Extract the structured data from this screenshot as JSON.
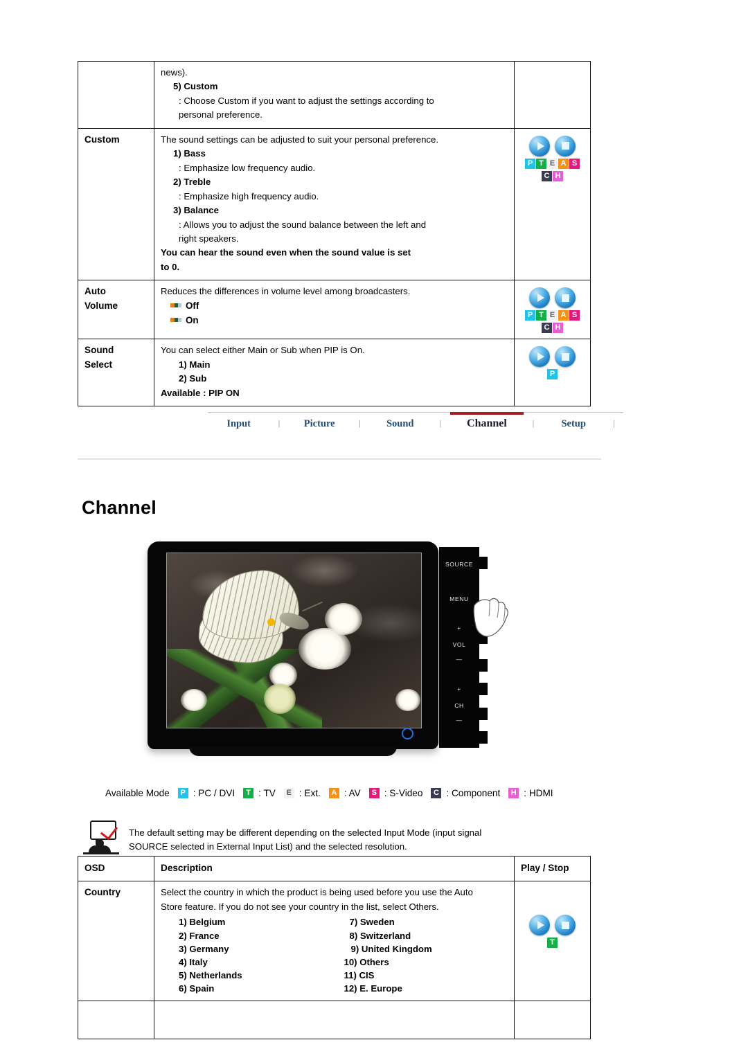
{
  "top_table": {
    "rows": [
      {
        "osd": "",
        "lines": [
          {
            "type": "plain",
            "text": "news)."
          },
          {
            "type": "num_head",
            "text": "5) Custom"
          },
          {
            "type": "num_body",
            "text": ": Choose Custom if you want to adjust the settings according to"
          },
          {
            "type": "num_body_cont",
            "text": "personal preference."
          }
        ],
        "icons": null
      },
      {
        "osd": "Custom",
        "lines": [
          {
            "type": "plain",
            "text": "The sound settings can be adjusted to suit your personal preference."
          },
          {
            "type": "num_head",
            "text": "1) Bass"
          },
          {
            "type": "num_body",
            "text": ": Emphasize low frequency audio."
          },
          {
            "type": "num_head",
            "text": "2) Treble"
          },
          {
            "type": "num_body",
            "text": ": Emphasize high frequency audio."
          },
          {
            "type": "num_head",
            "text": "3) Balance"
          },
          {
            "type": "num_body",
            "text": ": Allows you to adjust the sound balance between the left and"
          },
          {
            "type": "num_body_cont",
            "text": "right speakers."
          },
          {
            "type": "bold_note",
            "text": "You can hear the sound even when the sound value is set"
          },
          {
            "type": "bold_note",
            "text": "to 0."
          }
        ],
        "icons": {
          "spheres": [
            "play-icon",
            "stop-icon"
          ],
          "badges": [
            "P",
            "T",
            "E",
            "A",
            "S",
            "C",
            "H"
          ]
        }
      },
      {
        "osd": "Auto\nVolume",
        "osd_l1": "Auto",
        "osd_l2": "Volume",
        "lines": [
          {
            "type": "plain",
            "text": "Reduces the differences in volume level among broadcasters."
          },
          {
            "type": "bullet",
            "text": "Off"
          },
          {
            "type": "bullet",
            "text": "On"
          }
        ],
        "icons": {
          "spheres": [
            "play-icon",
            "stop-icon"
          ],
          "badges": [
            "P",
            "T",
            "E",
            "A",
            "S",
            "C",
            "H"
          ]
        }
      },
      {
        "osd_l1": "Sound",
        "osd_l2": "Select",
        "lines": [
          {
            "type": "plain",
            "text": "You can select either Main or Sub when PIP is On."
          },
          {
            "type": "opt",
            "text": "1) Main"
          },
          {
            "type": "opt",
            "text": "2) Sub"
          },
          {
            "type": "avail",
            "text": "Available : PIP ON"
          }
        ],
        "icons": {
          "spheres": [
            "play-icon",
            "stop-icon"
          ],
          "badges": [
            "P"
          ]
        }
      }
    ]
  },
  "nav": {
    "items": [
      {
        "label": "Input",
        "active": false
      },
      {
        "label": "Picture",
        "active": false
      },
      {
        "label": "Sound",
        "active": false
      },
      {
        "label": "Channel",
        "active": true
      },
      {
        "label": "Setup",
        "active": false
      }
    ],
    "separator": "|",
    "active_color": "#a32020"
  },
  "page_title": "Channel",
  "monitor": {
    "buttons": [
      "SOURCE",
      "MENU",
      "+",
      "VOL",
      "—",
      "+",
      "CH",
      "—"
    ],
    "screen_alt": "butterfly-on-white-flowers-photo"
  },
  "available_mode": {
    "label": "Available Mode",
    "entries": [
      {
        "badge": "P",
        "text": ": PC / DVI",
        "color": "#21c3e8"
      },
      {
        "badge": "T",
        "text": ": TV",
        "color": "#17ae4a"
      },
      {
        "badge": "E",
        "text": ": Ext.",
        "color": "#f2f2f2"
      },
      {
        "badge": "A",
        "text": ": AV",
        "color": "#f59018"
      },
      {
        "badge": "S",
        "text": ": S-Video",
        "color": "#e4197e"
      },
      {
        "badge": "C",
        "text": ": Component",
        "color": "#3b3b52"
      },
      {
        "badge": "H",
        "text": ": HDMI",
        "color": "#e65fd2"
      }
    ]
  },
  "note": {
    "line1": "The default setting may be different depending on the selected Input Mode (input signal",
    "line2": "SOURCE selected in External Input List) and the selected resolution."
  },
  "bottom_table": {
    "headers": {
      "osd": "OSD",
      "description": "Description",
      "play_stop": "Play / Stop"
    },
    "country_row": {
      "osd": "Country",
      "desc_line1": "Select the country in which the product is being used before you use the Auto",
      "desc_line2": "Store feature. If you do not see your country in the list, select Others.",
      "options_left": [
        "1) Belgium",
        "2) France",
        "3) Germany",
        "4) Italy",
        "5) Netherlands",
        "6) Spain"
      ],
      "options_right": [
        "7) Sweden",
        "8) Switzerland",
        "9) United Kingdom",
        "10) Others",
        "11) CIS",
        "12) E. Europe"
      ],
      "icons": {
        "spheres": [
          "play-icon",
          "stop-icon"
        ],
        "badges": [
          "T"
        ]
      }
    }
  }
}
